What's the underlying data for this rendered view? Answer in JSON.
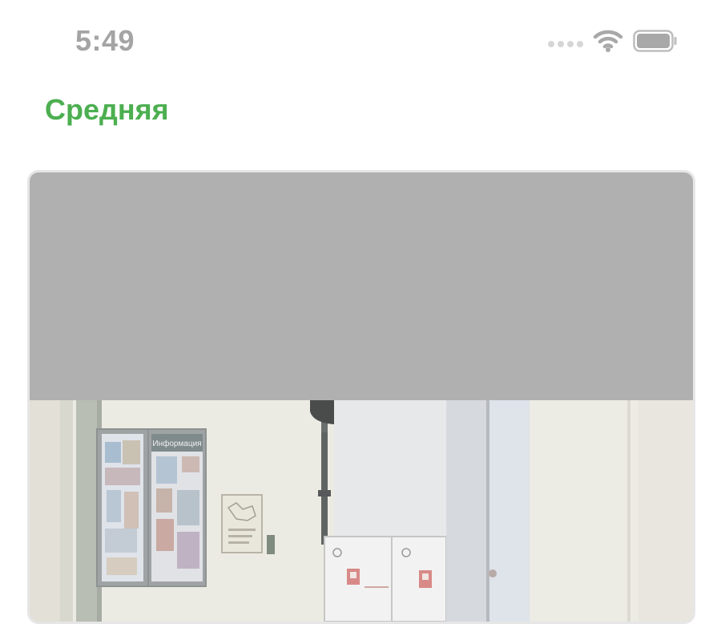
{
  "status_bar": {
    "time": "5:49",
    "icons": [
      "signal-icon",
      "wifi-icon",
      "battery-icon"
    ]
  },
  "section": {
    "title": "Средняя",
    "title_color": "#4caf50"
  },
  "photo_card": {
    "placeholder_color": "#b0b0b0",
    "image_sign_text": "Информация"
  }
}
